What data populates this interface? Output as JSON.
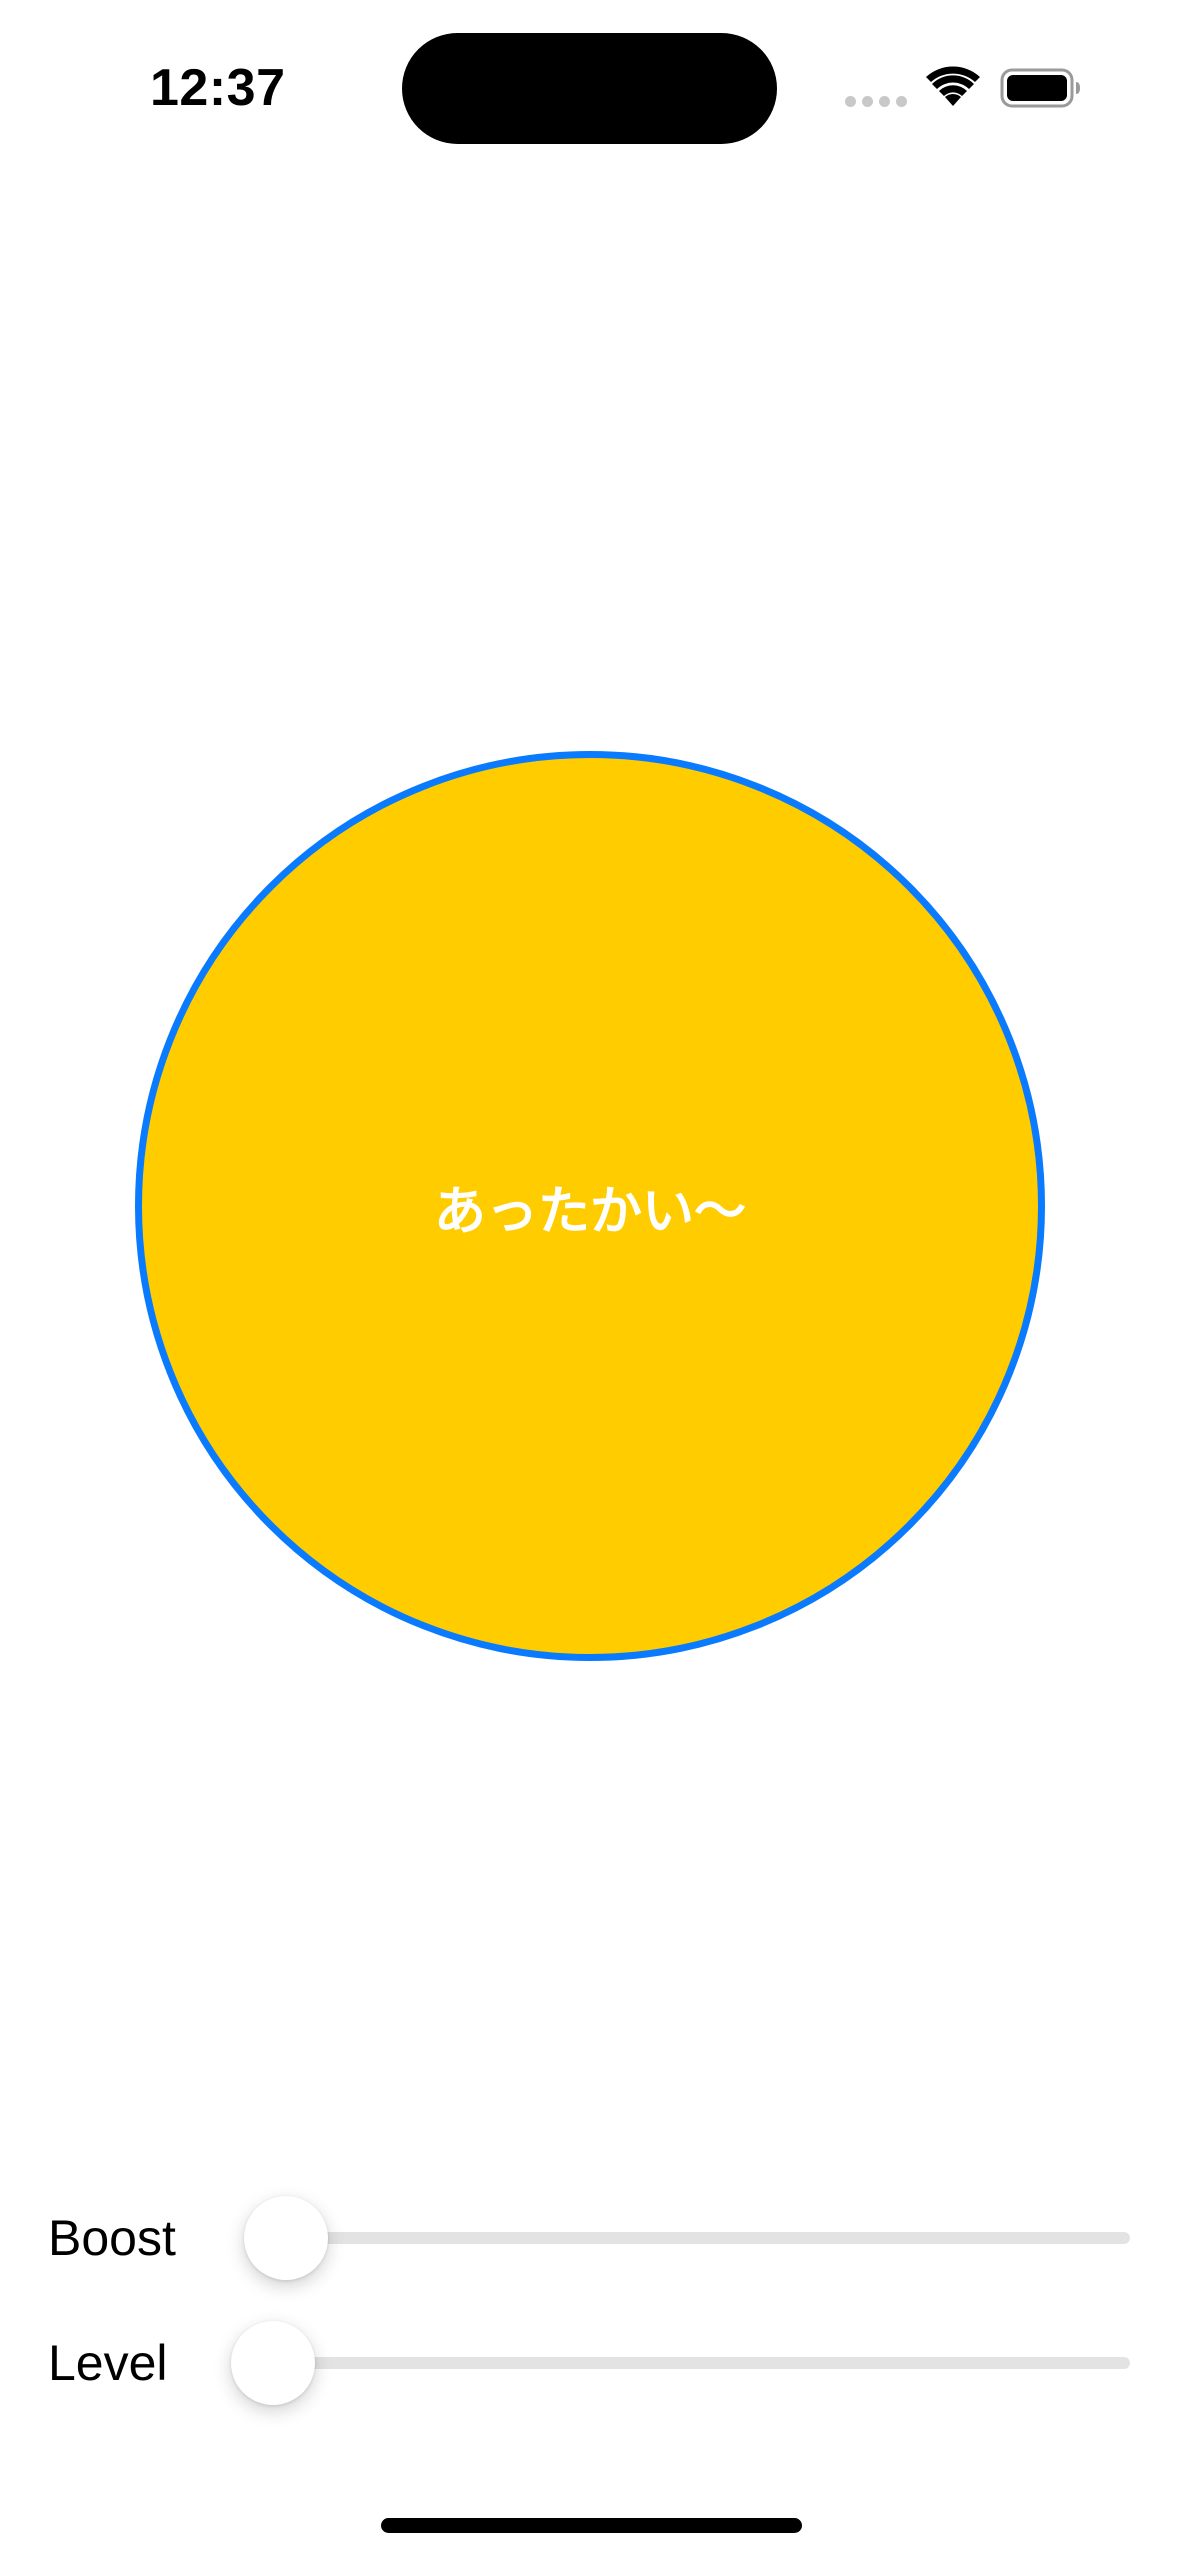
{
  "status_bar": {
    "time": "12:37",
    "icons": [
      "cellular-signal-icon",
      "wifi-icon",
      "battery-icon"
    ]
  },
  "circle": {
    "label": "あったかい〜",
    "fill_color": "#ffcc00",
    "border_color": "#0a7bff",
    "text_color": "#ffffff"
  },
  "sliders": [
    {
      "label": "Boost",
      "value": 0
    },
    {
      "label": "Level",
      "value": 0
    }
  ]
}
